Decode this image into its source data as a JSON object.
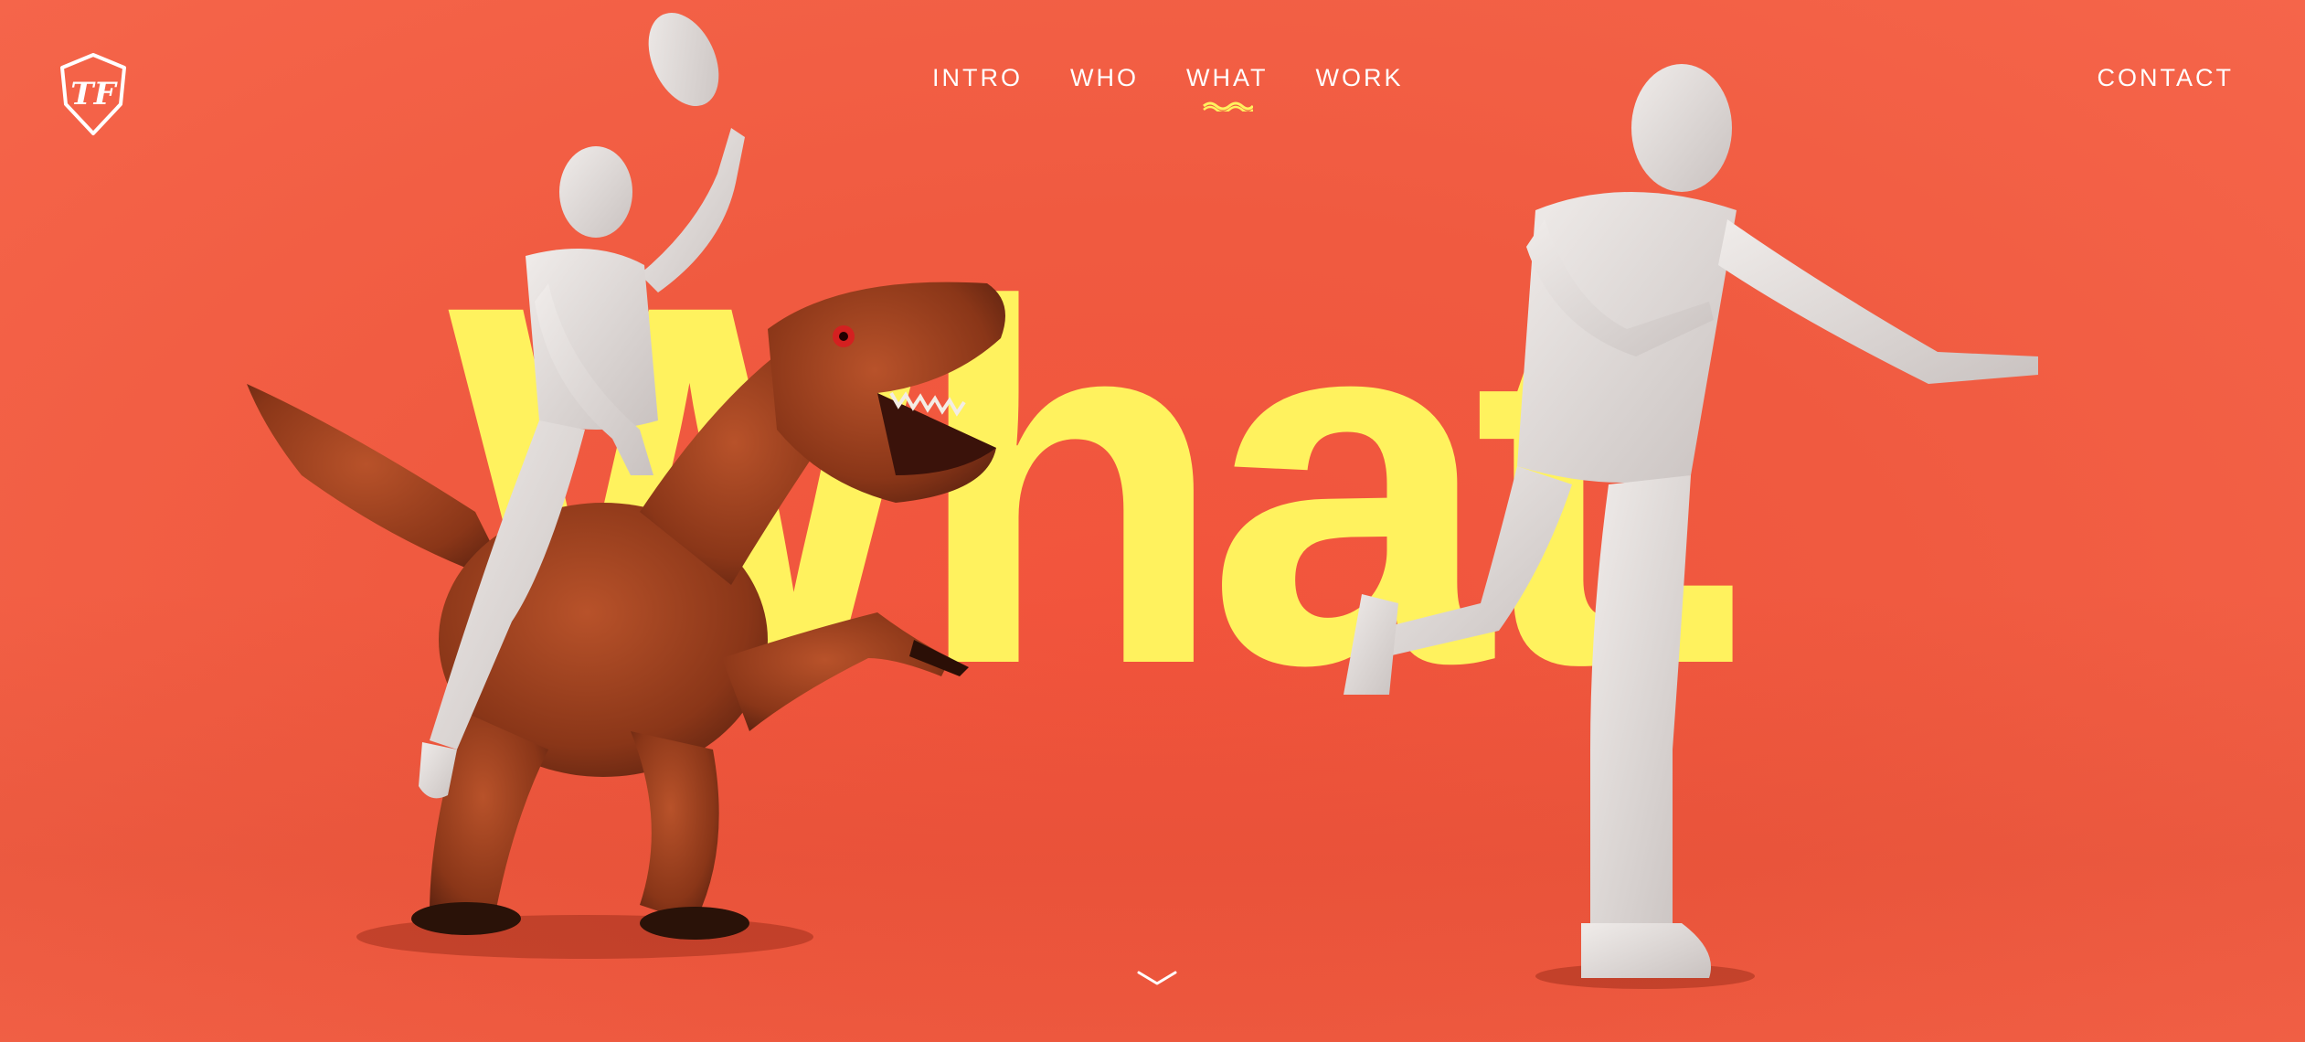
{
  "logo": {
    "text": "TF",
    "icon": "tf-shield-logo-icon"
  },
  "nav": {
    "items": [
      {
        "label": "INTRO"
      },
      {
        "label": "WHO"
      },
      {
        "label": "WHAT",
        "active": true
      },
      {
        "label": "WORK"
      }
    ],
    "contact": "CONTACT"
  },
  "hero": {
    "headline": "What."
  },
  "colors": {
    "background": "#f05a40",
    "headline": "#fff25e",
    "nav_text": "#ffffff",
    "active_underline": "#fff25e",
    "dinosaur": "#9a3e1e",
    "figures": "#e4dfdd"
  },
  "icons": {
    "scroll": "chevron-down-icon"
  }
}
